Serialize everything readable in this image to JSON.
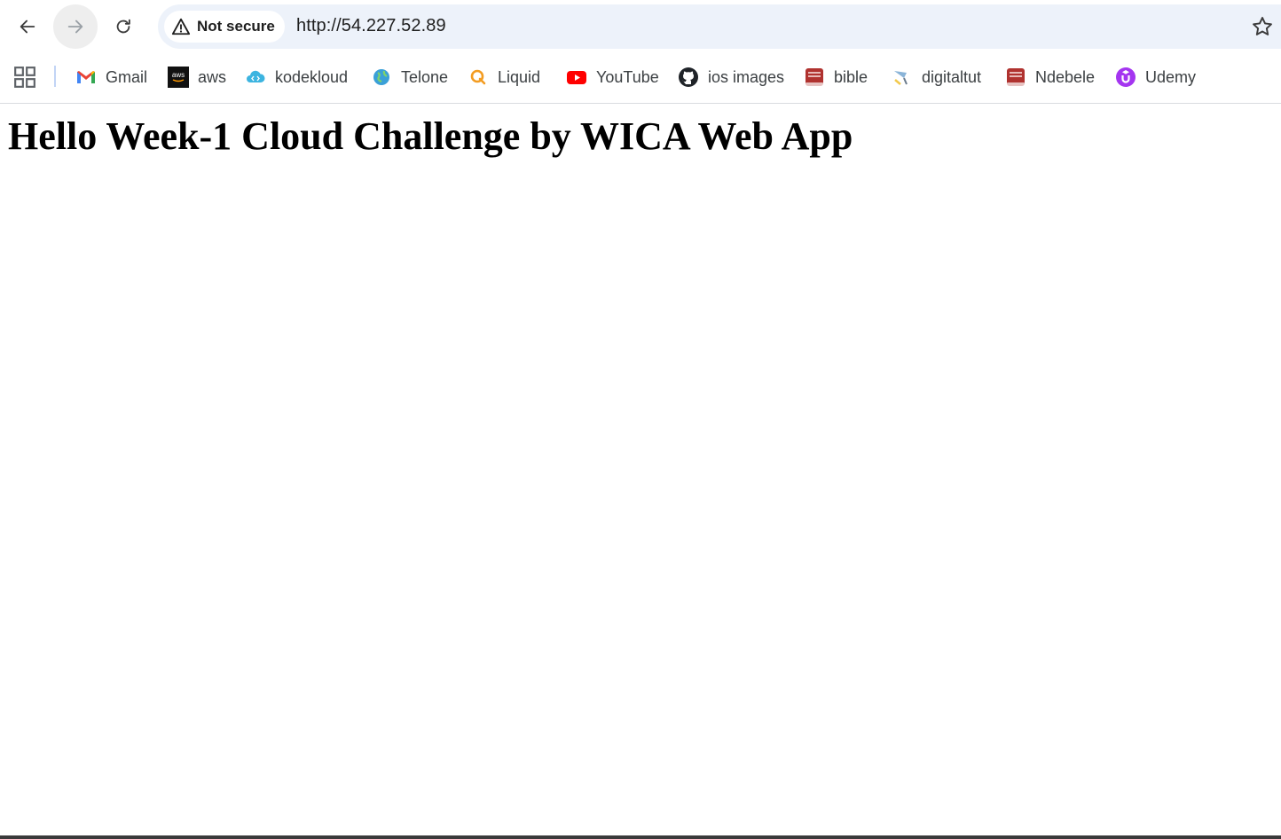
{
  "toolbar": {
    "back_icon": "arrow-left-icon",
    "forward_icon": "arrow-right-icon",
    "reload_icon": "reload-icon"
  },
  "omnibox": {
    "security_label": "Not secure",
    "security_icon": "warning-triangle-icon",
    "url": "http://54.227.52.89",
    "bookmark_star_icon": "star-outline-icon"
  },
  "bookmarks": {
    "apps_icon": "apps-grid-icon",
    "items": [
      {
        "label": "Gmail",
        "icon": "gmail-icon"
      },
      {
        "label": "aws",
        "icon": "aws-icon"
      },
      {
        "label": "kodekloud",
        "icon": "kodekloud-icon"
      },
      {
        "label": "Telone",
        "icon": "globe-icon"
      },
      {
        "label": "Liquid",
        "icon": "liquid-icon"
      },
      {
        "label": "YouTube",
        "icon": "youtube-icon"
      },
      {
        "label": "ios images",
        "icon": "github-icon"
      },
      {
        "label": "bible",
        "icon": "bible-icon"
      },
      {
        "label": "digitaltut",
        "icon": "digitaltut-icon"
      },
      {
        "label": "Ndebele",
        "icon": "bible-icon"
      },
      {
        "label": "Udemy",
        "icon": "udemy-icon"
      }
    ]
  },
  "page": {
    "heading": "Hello Week-1 Cloud Challenge by WICA Web App"
  },
  "colors": {
    "omnibox_bg": "#edf2fa",
    "text": "#1f1f1f",
    "youtube_red": "#ff0000",
    "udemy_purple": "#a435f0",
    "bible_red": "#b0322f"
  }
}
